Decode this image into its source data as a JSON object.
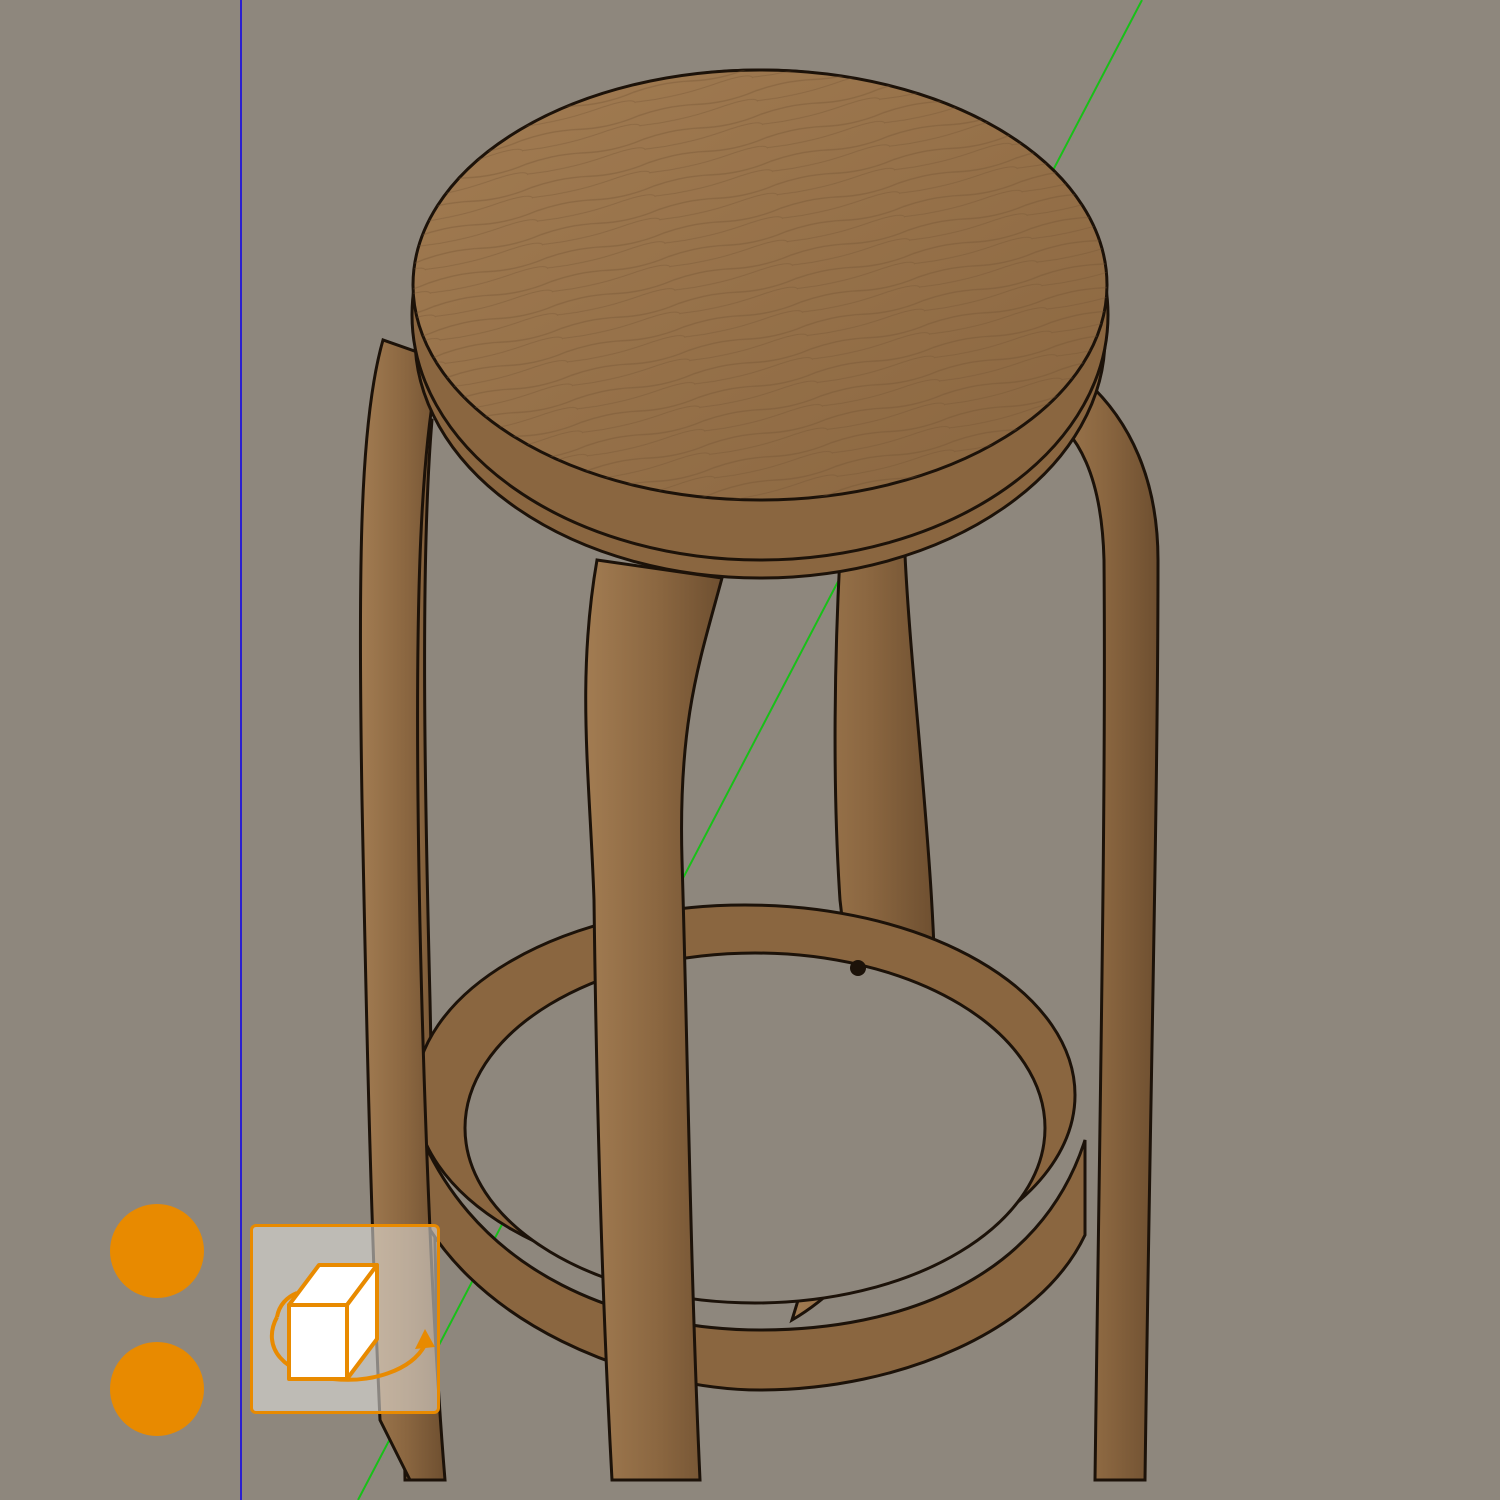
{
  "viewport": {
    "background_color": "#8e877d",
    "axis_blue_color": "#2a1fd0",
    "axis_green_color": "#18c018"
  },
  "model": {
    "name": "wooden-bar-stool",
    "wood_base_color": "#8a6640",
    "wood_light_color": "#a27c52",
    "wood_dark_color": "#6e4f30",
    "edge_color": "#1c1209"
  },
  "overlay": {
    "accent_color": "#e88a00",
    "buttons": [
      {
        "name": "toolbar-dot-1"
      },
      {
        "name": "toolbar-dot-2"
      }
    ],
    "orbit_tool": {
      "icon": "orbit-icon",
      "active": true
    }
  }
}
